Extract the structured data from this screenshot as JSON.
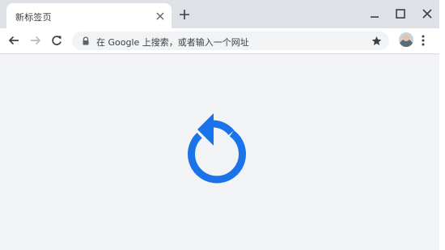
{
  "tab": {
    "title": "新标签页"
  },
  "omnibox": {
    "text": "在 Google 上搜索，或者输入一个网址"
  },
  "icons": {
    "tab_close": "close-icon",
    "new_tab": "plus-icon",
    "minimize": "minimize-icon",
    "maximize": "maximize-icon",
    "close_window": "close-icon",
    "back": "back-arrow-icon",
    "forward": "forward-arrow-icon",
    "reload": "reload-icon",
    "lock": "lock-icon",
    "bookmark": "star-icon",
    "menu": "more-vert-icon",
    "page_graphic": "reload-icon"
  },
  "colors": {
    "accent": "#1a73e8",
    "tabstrip": "#dee1e6",
    "content_bg": "#f1f3f4"
  }
}
